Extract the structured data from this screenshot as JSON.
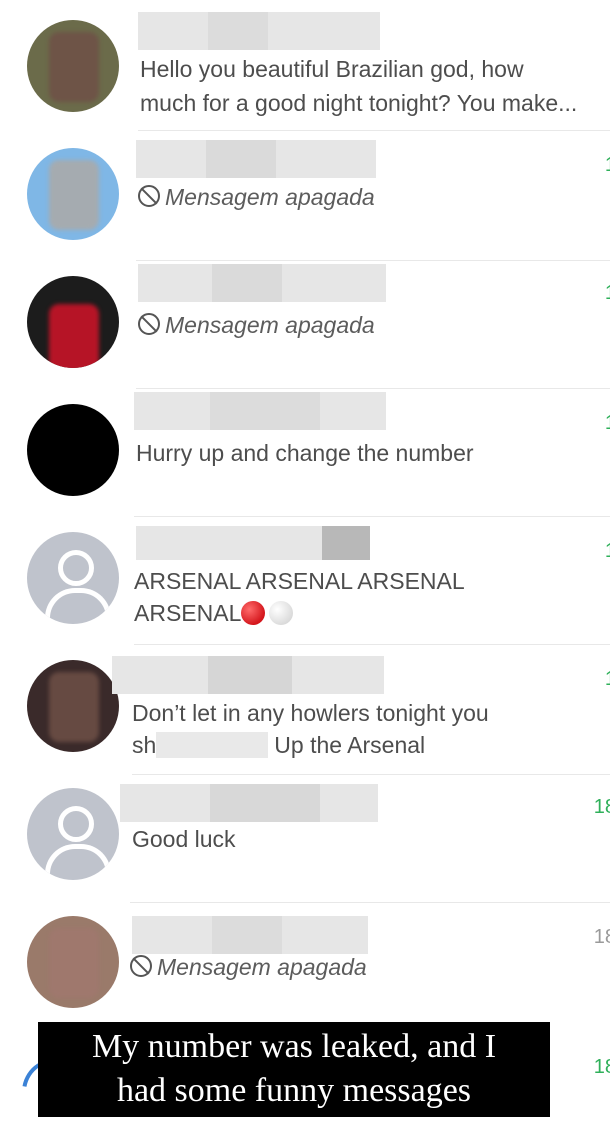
{
  "chats": [
    {
      "message": "Hello you beautiful Brazilian god, how",
      "message_line2": "much for a good night tonight? You make...",
      "time": ""
    },
    {
      "message": "Mensagem apagada",
      "deleted": true,
      "time": "1"
    },
    {
      "message": "Mensagem apagada",
      "deleted": true,
      "time": "1"
    },
    {
      "message": "Hurry up and change the number",
      "time": "1"
    },
    {
      "message": "ARSENAL ARSENAL ARSENAL",
      "message_line2": "ARSENAL",
      "time": "1"
    },
    {
      "message": "Don’t let in any howlers tonight you",
      "message_line2_a": "sh",
      "message_line2_b": "Up the Arsenal",
      "time": "1"
    },
    {
      "message": "Good luck",
      "time": "18"
    },
    {
      "message": "Mensagem apagada",
      "deleted": true,
      "time": "18"
    },
    {
      "time": "18"
    }
  ],
  "caption": {
    "line1": "My number was leaked, and I",
    "line2": "had some funny messages"
  },
  "colors": {
    "accent_green": "#2fb05a",
    "caption_bg": "#000000"
  }
}
